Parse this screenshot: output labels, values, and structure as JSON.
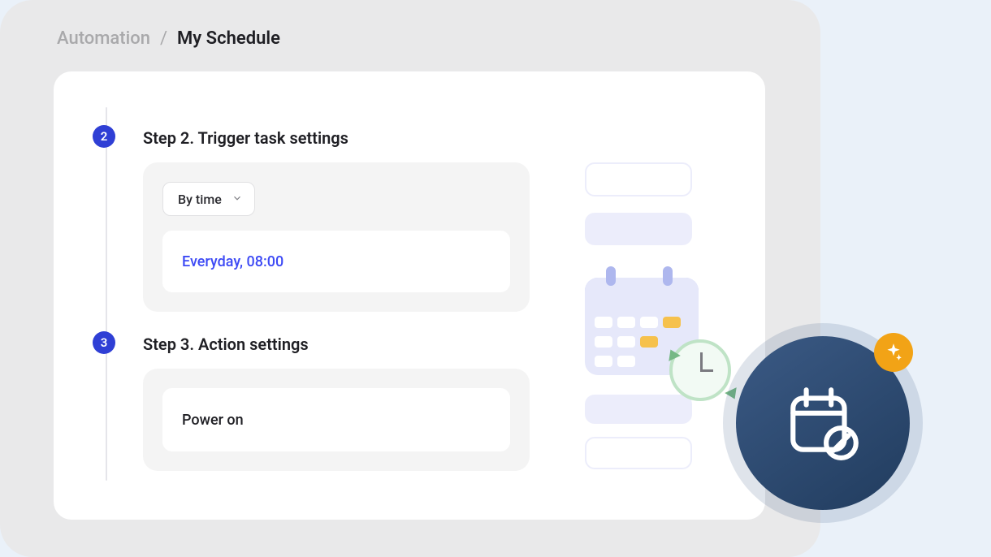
{
  "breadcrumb": {
    "parent": "Automation",
    "separator": "/",
    "current": "My Schedule"
  },
  "steps": {
    "s2": {
      "number": "2",
      "title": "Step 2. Trigger task settings",
      "trigger_type_label": "By time",
      "trigger_summary": "Everyday,  08:00"
    },
    "s3": {
      "number": "3",
      "title": "Step 3. Action settings",
      "action_summary": "Power on"
    }
  },
  "icons": {
    "chevron_down": "chevron-down-icon",
    "calendar": "calendar-icon",
    "clock_refresh": "clock-refresh-icon",
    "schedule_edit": "schedule-edit-icon",
    "sparkle": "sparkle-icon"
  },
  "colors": {
    "accent_blue": "#3d4af5",
    "step_badge": "#2f3fd5",
    "fab_bg": "#2c4a70",
    "fab_spark": "#f2a316"
  }
}
